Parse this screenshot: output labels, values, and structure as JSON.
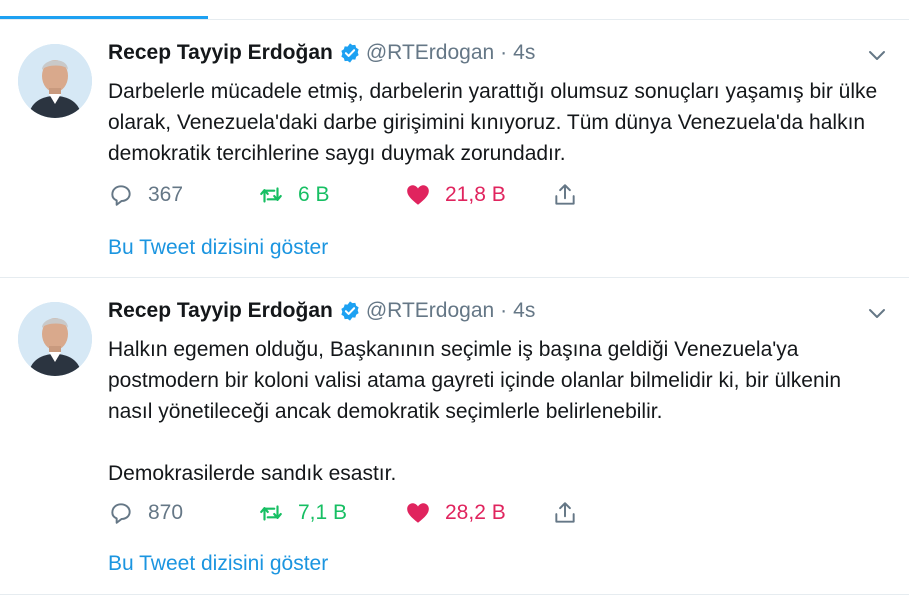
{
  "colors": {
    "accent": "#1da1f2",
    "link": "#1b95e0",
    "retweet": "#17bf63",
    "like": "#e0245e",
    "muted": "#657786"
  },
  "tweets": [
    {
      "name": "Recep Tayyip Erdoğan",
      "handle": "@RTErdogan",
      "separator": "·",
      "time": "4s",
      "text": "Darbelerle mücadele etmiş, darbelerin yarattığı olumsuz sonuçları yaşamış bir ülke olarak, Venezuela'daki darbe girişimini kınıyoruz. Tüm dünya Venezuela'da halkın demokratik tercihlerine saygı duymak zorundadır.",
      "replies": "367",
      "retweets": "6 B",
      "likes": "21,8 B",
      "show_thread": "Bu Tweet dizisini göster"
    },
    {
      "name": "Recep Tayyip Erdoğan",
      "handle": "@RTErdogan",
      "separator": "·",
      "time": "4s",
      "text": "Halkın egemen olduğu, Başkanının seçimle iş başına geldiği Venezuela'ya postmodern bir koloni valisi atama gayreti içinde olanlar bilmelidir ki, bir ülkenin nasıl yönetileceği ancak demokratik seçimlerle belirlenebilir.\n\nDemokrasilerde sandık esastır.",
      "replies": "870",
      "retweets": "7,1 B",
      "likes": "28,2 B",
      "show_thread": "Bu Tweet dizisini göster"
    }
  ]
}
